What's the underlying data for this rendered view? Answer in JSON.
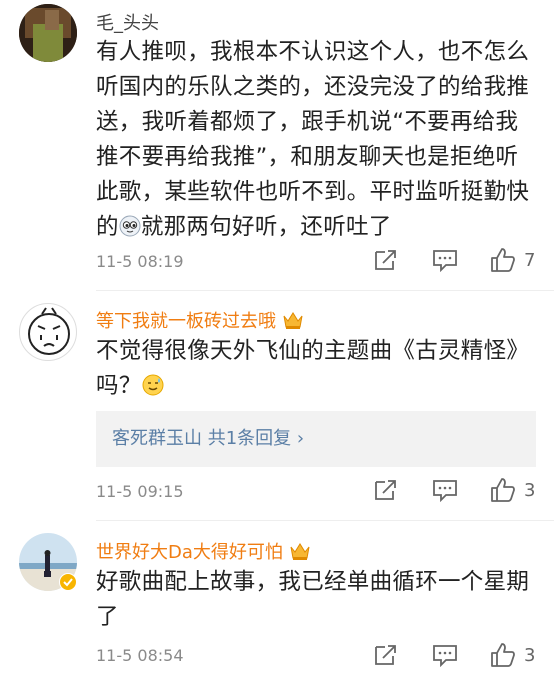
{
  "comments": [
    {
      "user": "毛_头头",
      "lines": [
        "有人推呗，我根本不认识这个人，也不怎么",
        "听国内的乐队之类的，还没完没了的给我推",
        "送，我听着都烦了，跟手机说“不要再给我",
        "推不要再给我推”，和朋友聊天也是拒绝听",
        "此歌，某些软件也听不到。平时监听挺勤快",
        "的",
        "就那两句好听，还听吐了"
      ],
      "emoji": "eyes-emoji",
      "time": "11-5 08:19",
      "likes": "7"
    },
    {
      "user": "等下我就一板砖过去哦",
      "badge": "crown-icon",
      "lines": [
        "不觉得很像天外飞仙的主题曲《古灵精怪》",
        "吗？"
      ],
      "emoji": "sweat-smile-emoji",
      "reply_text": "客死群玉山 共1条回复 ",
      "reply_chevron": "›",
      "time": "11-5 09:15",
      "likes": "3"
    },
    {
      "user": "世界好大Da大得好可怕",
      "badge": "crown-icon",
      "verified": "verified-badge-icon",
      "lines": [
        "好歌曲配上故事，我已经单曲循环一个星期",
        "了"
      ],
      "time": "11-5 08:54",
      "likes": "3"
    }
  ],
  "icons": {
    "share": "share-icon",
    "comment": "comment-icon",
    "like": "like-icon"
  },
  "colors": {
    "vip_name": "#f07d12",
    "reply_link": "#5b7fa6",
    "meta": "#8a8a8a"
  }
}
